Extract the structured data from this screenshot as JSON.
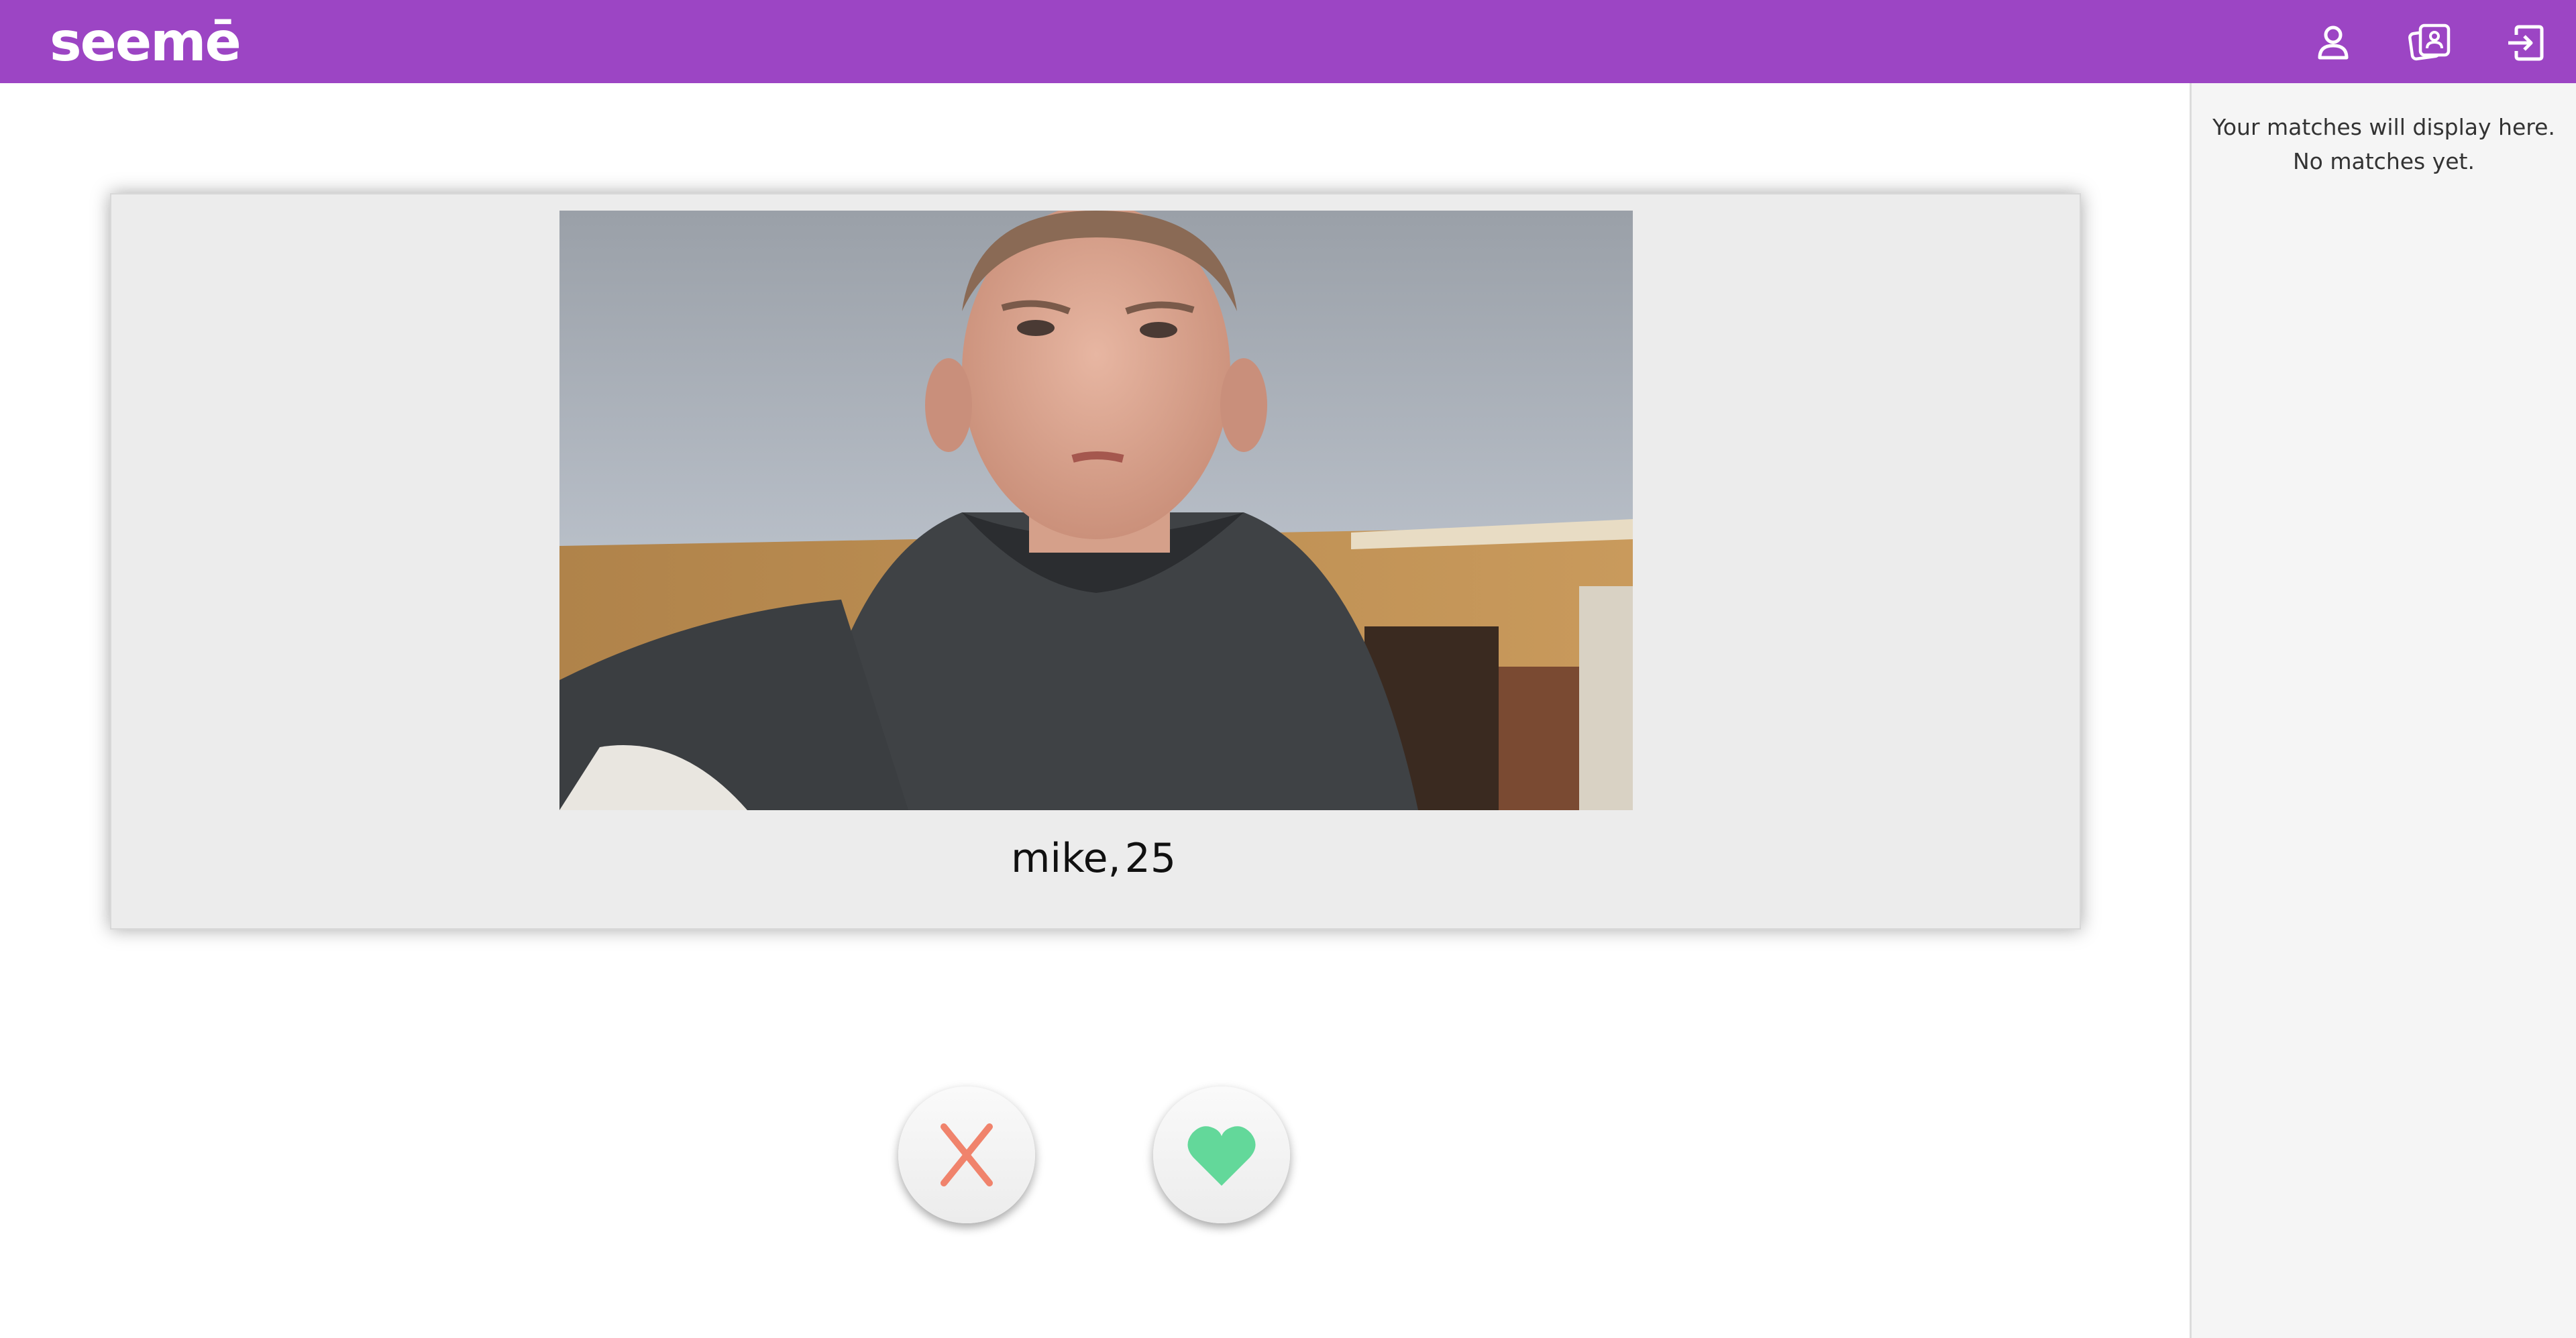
{
  "app": {
    "logo_text": "seemē",
    "brand_color": "#9c45c4"
  },
  "nav": {
    "icons": [
      "person-icon",
      "contact-card-icon",
      "logout-icon"
    ]
  },
  "profile_card": {
    "name": "mike",
    "separator": ",",
    "age": "25"
  },
  "actions": {
    "reject_icon": "x-icon",
    "reject_color": "#f0836c",
    "like_icon": "heart-icon",
    "like_color": "#63d89a"
  },
  "matches": {
    "line1": "Your matches will display here.",
    "line2": "No matches yet."
  }
}
